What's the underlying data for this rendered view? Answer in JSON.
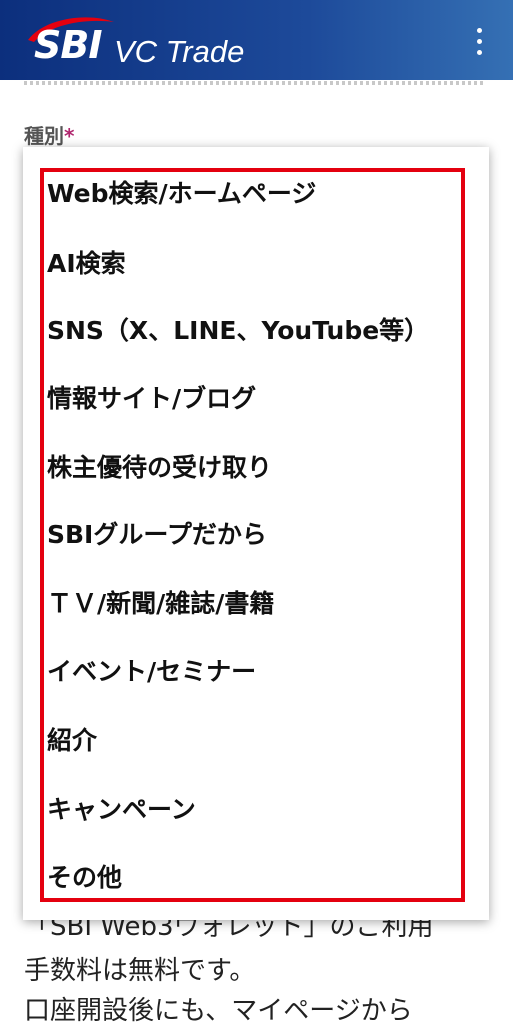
{
  "header": {
    "logo_sbi": "SBI",
    "logo_suffix": "VC Trade",
    "brand_color": "#0c2f7d",
    "logo_accent_color": "#e4000f",
    "menu_icon": "more-vertical-icon"
  },
  "form": {
    "field_label": "種別",
    "required_mark": "*",
    "background_text": [
      "「SBI Web3ウォレット」のご利用",
      "手数料は無料です。",
      "口座開設後にも、マイページから"
    ]
  },
  "dropdown": {
    "options": [
      "Web検索/ホームページ",
      "AI検索",
      "SNS（X、LINE、YouTube等）",
      "情報サイト/ブログ",
      "株主優待の受け取り",
      "SBIグループだから",
      "ＴＶ/新聞/雑誌/書籍",
      "イベント/セミナー",
      "紹介",
      "キャンペーン",
      "その他"
    ],
    "highlight_color": "#e4000f"
  }
}
